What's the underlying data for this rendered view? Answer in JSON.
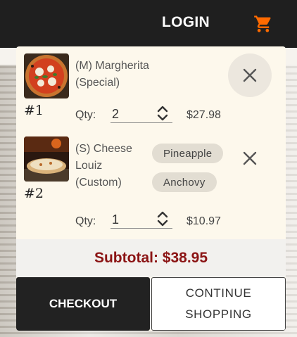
{
  "header": {
    "login_label": "LOGIN",
    "cart_icon": "shopping-cart-icon",
    "accent_color": "#ff6a00"
  },
  "cart": {
    "items": [
      {
        "number": "#1",
        "name_line1": "(M) Margherita",
        "name_line2": "(Special)",
        "qty_label": "Qty:",
        "qty": "2",
        "price": "$27.98",
        "toppings": []
      },
      {
        "number": "#2",
        "name_line1": "(S) Cheese",
        "name_line2": "Louiz",
        "name_line3": "(Custom)",
        "qty_label": "Qty:",
        "qty": "1",
        "price": "$10.97",
        "toppings": [
          "Pineapple",
          "Anchovy"
        ]
      }
    ],
    "subtotal": "Subtotal: $38.95",
    "subtotal_color": "#8b1414"
  },
  "actions": {
    "checkout_label": "CHECKOUT",
    "continue_line1": "CONTINUE",
    "continue_line2": "SHOPPING"
  }
}
